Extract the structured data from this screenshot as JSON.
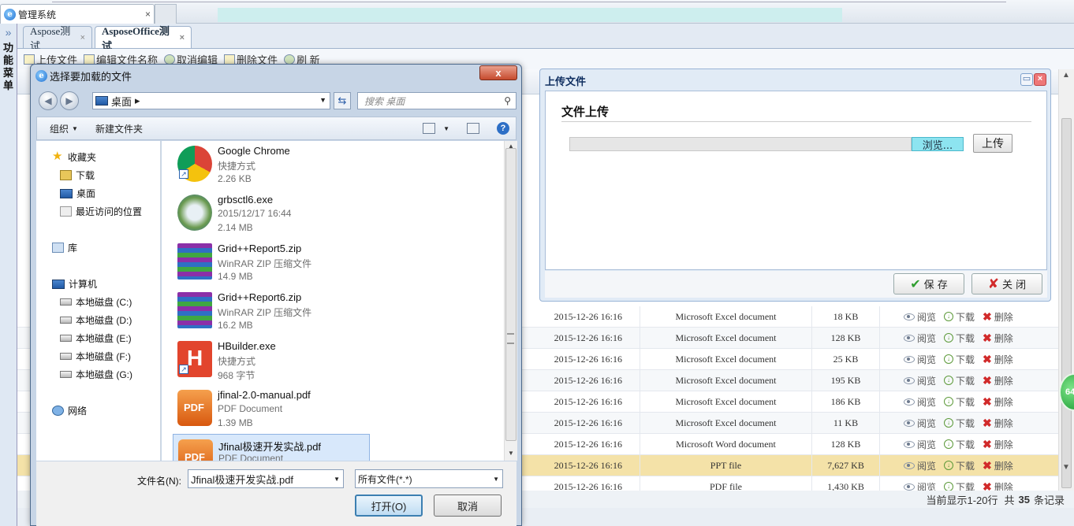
{
  "browser": {
    "tab_title": "管理系统",
    "tab_close": "×",
    "ie_glyph": "e"
  },
  "sidebar": {
    "arrow": "»",
    "label": "功能菜单"
  },
  "tabs": [
    {
      "label": "Aspose测试",
      "close": "×"
    },
    {
      "label": "AsposeOffice测试",
      "close": "×"
    }
  ],
  "toolbar": [
    {
      "label": "上传文件"
    },
    {
      "label": "编辑文件名称"
    },
    {
      "label": "取消编辑"
    },
    {
      "label": "删除文件"
    },
    {
      "label": "刷 新"
    }
  ],
  "grid": {
    "ops": {
      "view": "阅览",
      "download": "下载",
      "delete": "删除"
    },
    "rows": [
      {
        "date": "2015-12-26 16:16",
        "type": "Microsoft Excel document",
        "size": "18 KB"
      },
      {
        "date": "2015-12-26 16:16",
        "type": "Microsoft Excel document",
        "size": "128 KB"
      },
      {
        "date": "2015-12-26 16:16",
        "type": "Microsoft Excel document",
        "size": "25 KB"
      },
      {
        "date": "2015-12-26 16:16",
        "type": "Microsoft Excel document",
        "size": "195 KB"
      },
      {
        "date": "2015-12-26 16:16",
        "type": "Microsoft Excel document",
        "size": "186 KB"
      },
      {
        "date": "2015-12-26 16:16",
        "type": "Microsoft Excel document",
        "size": "11 KB"
      },
      {
        "date": "2015-12-26 16:16",
        "type": "Microsoft Word document",
        "size": "128 KB"
      },
      {
        "date": "2015-12-26 16:16",
        "type": "PPT file",
        "size": "7,627 KB"
      },
      {
        "date": "2015-12-26 16:16",
        "type": "PDF file",
        "size": "1,430 KB"
      }
    ],
    "selected_row_index": 7
  },
  "footer": {
    "prefix": "当前显示1-20行",
    "total_label": "共",
    "total": "35",
    "suffix": "条记录"
  },
  "badge": {
    "text": "64"
  },
  "upload_panel": {
    "title": "上传文件",
    "min_icon": "▭",
    "close_icon": "×",
    "heading": "文件上传",
    "browse_label": "浏览...",
    "upload_label": "上传",
    "save_label": "保 存",
    "close_label": "关 闭"
  },
  "file_dialog": {
    "title": "选择要加载的文件",
    "close_glyph": "x",
    "address": "桌面",
    "address_arrow": "▸",
    "search_placeholder": "搜索 桌面",
    "commands": {
      "organize": "组织",
      "new_folder": "新建文件夹",
      "help": "?"
    },
    "nav": {
      "favorites": "收藏夹",
      "downloads": "下载",
      "desktop": "桌面",
      "recent": "最近访问的位置",
      "library": "库",
      "computer": "计算机",
      "drives": [
        "本地磁盘 (C:)",
        "本地磁盘 (D:)",
        "本地磁盘 (E:)",
        "本地磁盘 (F:)",
        "本地磁盘 (G:)"
      ],
      "network": "网络"
    },
    "files": [
      {
        "name": "Google Chrome",
        "desc": "快捷方式",
        "size": "2.26 KB",
        "icon": "chrome-icon"
      },
      {
        "name": "grbsctl6.exe",
        "desc": "2015/12/17 16:44",
        "size": "2.14 MB",
        "icon": "installer-icon"
      },
      {
        "name": "Grid++Report5.zip",
        "desc": "WinRAR ZIP 压缩文件",
        "size": "14.9 MB",
        "icon": "winrar-icon"
      },
      {
        "name": "Grid++Report6.zip",
        "desc": "WinRAR ZIP 压缩文件",
        "size": "16.2 MB",
        "icon": "winrar-icon"
      },
      {
        "name": "HBuilder.exe",
        "desc": "快捷方式",
        "size": "968 字节",
        "icon": "hbuilder-icon"
      },
      {
        "name": "jfinal-2.0-manual.pdf",
        "desc": "PDF Document",
        "size": "1.39 MB",
        "icon": "pdf-icon"
      },
      {
        "name": "Jfinal极速开发实战.pdf",
        "desc": "PDF Document",
        "size": "",
        "icon": "pdf-icon"
      }
    ],
    "filename_label": "文件名(N):",
    "filename_value": "Jfinal极速开发实战.pdf",
    "filetype_value": "所有文件(*.*)",
    "open_label": "打开(O)",
    "cancel_label": "取消"
  },
  "colors": {
    "selected_row": "#f4e2a8",
    "upload_browse": "#8de4f0",
    "dialog_frame": "#c7d5e6"
  }
}
